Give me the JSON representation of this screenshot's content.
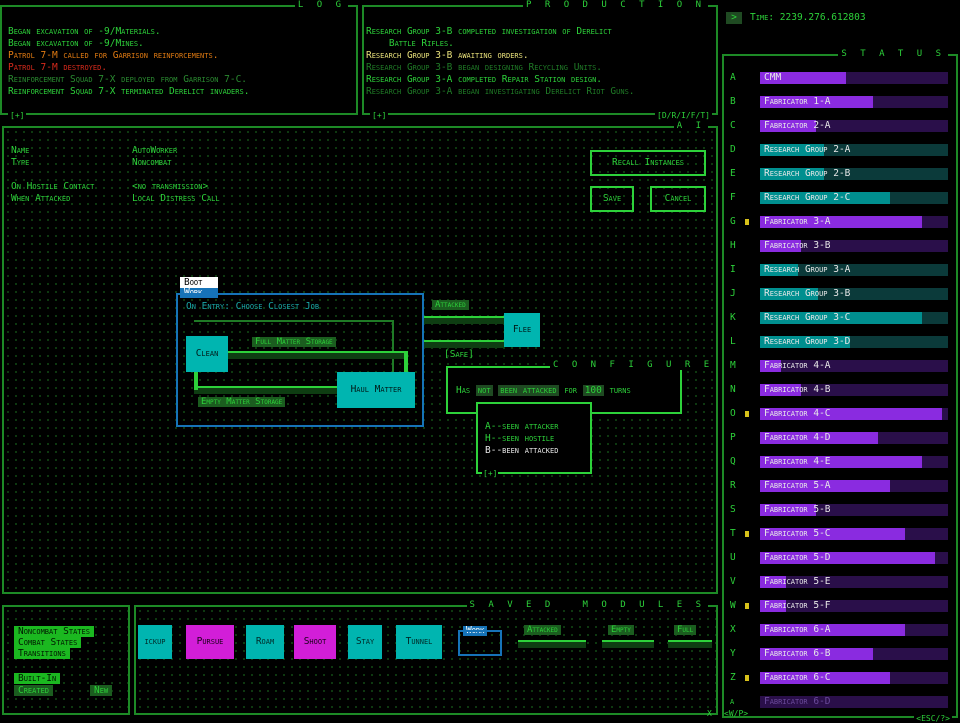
{
  "log": {
    "title": "L O G",
    "lines": [
      {
        "text": "Began excavation of -9/Materials.",
        "color": "#2dd13a"
      },
      {
        "text": "Began excavation of -9/Mines.",
        "color": "#2dd13a"
      },
      {
        "text": "Patrol 7-M called for Garrison reinforcements.",
        "color": "#e07a12"
      },
      {
        "text": "Patrol 7-M destroyed.",
        "color": "#d82a1c"
      },
      {
        "text": "Reinforcement Squad 7-X deployed from Garrison 7-C.",
        "color": "#2a8a30"
      },
      {
        "text": "Reinforcement Squad 7-X terminated Derelict invaders.",
        "color": "#2dd13a"
      }
    ],
    "plus": "[+]"
  },
  "production": {
    "title": "P R O D U C T I O N",
    "lines": [
      {
        "text": "Research Group 3-B completed investigation of Derelict",
        "color": "#2dd13a"
      },
      {
        "text": "    Battle Rifles.",
        "color": "#2dd13a"
      },
      {
        "text": "Research Group 3-B awaiting orders.",
        "color": "#e8e07a"
      },
      {
        "text": "Research Group 3-B began designing Recycling Units.",
        "color": "#1f7a26"
      },
      {
        "text": "Research Group 3-A completed Repair Station design.",
        "color": "#2dd13a"
      },
      {
        "text": "Research Group 3-A began investigating Derelict Riot Guns.",
        "color": "#1f7a26"
      }
    ],
    "plus": "[+]",
    "filters": "[D/R/I/F/T]"
  },
  "time": {
    "arrow": ">",
    "label": "Time: 2239.276.612803"
  },
  "ai": {
    "title": "A I",
    "fields": [
      {
        "key": "Name",
        "value": "AutoWorker"
      },
      {
        "key": "Type",
        "value": "Noncombat"
      },
      {
        "key": "On Hostile Contact",
        "value": "<no transmission>"
      },
      {
        "key": "When Attacked",
        "value": "Local Distress Call"
      }
    ],
    "recall": "Recall Instances",
    "save": "Save",
    "cancel": "Cancel",
    "graph": {
      "boot": "Boot",
      "work": "Work",
      "on_entry": "On Entry: Choose Closest Job",
      "clean": "Clean",
      "haul": "Haul Matter",
      "flee": "Flee",
      "full": "Full Matter Storage",
      "empty": "Empty Matter Storage",
      "attacked": "Attacked",
      "safe": "[Safe]"
    },
    "configure": {
      "title": "C O N F I G U R E",
      "has": "Has",
      "not": "not",
      "been": "been attacked",
      "for": "for",
      "turns_num": "100",
      "turns": "turns",
      "options": [
        "A--seen attacker",
        "H--seen hostile",
        "B--been attacked"
      ],
      "plus": "[+]"
    }
  },
  "status": {
    "title": "S T A T U S",
    "rows": [
      {
        "letter": "A",
        "label": "CMM",
        "fill": 0.46,
        "color": "#8a2be0",
        "bg": "#2a0f4a",
        "flag": false
      },
      {
        "letter": "B",
        "label": "Fabricator 1-A",
        "fill": 0.6,
        "color": "#8a2be0",
        "bg": "#2a0f4a",
        "flag": false
      },
      {
        "letter": "C",
        "label": "Fabricator 2-A",
        "fill": 0.3,
        "color": "#8a2be0",
        "bg": "#2a0f4a",
        "flag": false
      },
      {
        "letter": "D",
        "label": "Research Group 2-A",
        "fill": 0.34,
        "color": "#008f8f",
        "bg": "#0b3a3a",
        "flag": false
      },
      {
        "letter": "E",
        "label": "Research Group 2-B",
        "fill": 0.34,
        "color": "#008f8f",
        "bg": "#0b3a3a",
        "flag": false
      },
      {
        "letter": "F",
        "label": "Research Group 2-C",
        "fill": 0.69,
        "color": "#008f8f",
        "bg": "#0b3a3a",
        "flag": false
      },
      {
        "letter": "G",
        "label": "Fabricator 3-A",
        "fill": 0.86,
        "color": "#8a2be0",
        "bg": "#2a0f4a",
        "flag": true
      },
      {
        "letter": "H",
        "label": "Fabricator 3-B",
        "fill": 0.22,
        "color": "#8a2be0",
        "bg": "#2a0f4a",
        "flag": false
      },
      {
        "letter": "I",
        "label": "Research Group 3-A",
        "fill": 0.2,
        "color": "#008f8f",
        "bg": "#0b3a3a",
        "flag": false
      },
      {
        "letter": "J",
        "label": "Research Group 3-B",
        "fill": 0.31,
        "color": "#008f8f",
        "bg": "#0b3a3a",
        "flag": false
      },
      {
        "letter": "K",
        "label": "Research Group 3-C",
        "fill": 0.86,
        "color": "#008f8f",
        "bg": "#0b3a3a",
        "flag": false
      },
      {
        "letter": "L",
        "label": "Research Group 3-D",
        "fill": 0.48,
        "color": "#008f8f",
        "bg": "#0b3a3a",
        "flag": false
      },
      {
        "letter": "M",
        "label": "Fabricator 4-A",
        "fill": 0.11,
        "color": "#8a2be0",
        "bg": "#2a0f4a",
        "flag": false
      },
      {
        "letter": "N",
        "label": "Fabricator 4-B",
        "fill": 0.22,
        "color": "#8a2be0",
        "bg": "#2a0f4a",
        "flag": false
      },
      {
        "letter": "O",
        "label": "Fabricator 4-C",
        "fill": 0.97,
        "color": "#8a2be0",
        "bg": "#2a0f4a",
        "flag": true
      },
      {
        "letter": "P",
        "label": "Fabricator 4-D",
        "fill": 0.63,
        "color": "#8a2be0",
        "bg": "#2a0f4a",
        "flag": false
      },
      {
        "letter": "Q",
        "label": "Fabricator 4-E",
        "fill": 0.86,
        "color": "#8a2be0",
        "bg": "#2a0f4a",
        "flag": false
      },
      {
        "letter": "R",
        "label": "Fabricator 5-A",
        "fill": 0.69,
        "color": "#8a2be0",
        "bg": "#2a0f4a",
        "flag": false
      },
      {
        "letter": "S",
        "label": "Fabricator 5-B",
        "fill": 0.3,
        "color": "#8a2be0",
        "bg": "#2a0f4a",
        "flag": false
      },
      {
        "letter": "T",
        "label": "Fabricator 5-C",
        "fill": 0.77,
        "color": "#8a2be0",
        "bg": "#2a0f4a",
        "flag": true
      },
      {
        "letter": "U",
        "label": "Fabricator 5-D",
        "fill": 0.93,
        "color": "#8a2be0",
        "bg": "#2a0f4a",
        "flag": false
      },
      {
        "letter": "V",
        "label": "Fabricator 5-E",
        "fill": 0.14,
        "color": "#8a2be0",
        "bg": "#2a0f4a",
        "flag": false
      },
      {
        "letter": "W",
        "label": "Fabricator 5-F",
        "fill": 0.14,
        "color": "#8a2be0",
        "bg": "#2a0f4a",
        "flag": true
      },
      {
        "letter": "X",
        "label": "Fabricator 6-A",
        "fill": 0.77,
        "color": "#8a2be0",
        "bg": "#2a0f4a",
        "flag": false
      },
      {
        "letter": "Y",
        "label": "Fabricator 6-B",
        "fill": 0.6,
        "color": "#8a2be0",
        "bg": "#2a0f4a",
        "flag": false
      },
      {
        "letter": "Z",
        "label": "Fabricator 6-C",
        "fill": 0.69,
        "color": "#8a2be0",
        "bg": "#2a0f4a",
        "flag": true
      },
      {
        "letter": "a",
        "label": "Fabricator 6-D",
        "fill": 0.0,
        "color": "#8a2be0",
        "bg": "#2a0f4a",
        "flag": false
      }
    ],
    "bottom": "<ESC/?>"
  },
  "states": {
    "noncombat": "Noncombat States",
    "combat": "Combat States",
    "transitions": "Transitions",
    "builtin": "Built-In",
    "created": "Created",
    "new": "New"
  },
  "saved": {
    "title": "S A V E D   M O D U L E S",
    "modules": [
      {
        "label": "ickup",
        "color": "#00b5b0"
      },
      {
        "label": "Pursue",
        "color": "#d21ed8"
      },
      {
        "label": "Roam",
        "color": "#00b5b0"
      },
      {
        "label": "Shoot",
        "color": "#d21ed8"
      },
      {
        "label": "Stay",
        "color": "#00b5b0"
      },
      {
        "label": "Tunnel",
        "color": "#00b5b0"
      }
    ],
    "work": "Work",
    "transitions": [
      "Attacked",
      "Empty",
      "Full"
    ],
    "x": "X",
    "wp": "<W/P>"
  }
}
